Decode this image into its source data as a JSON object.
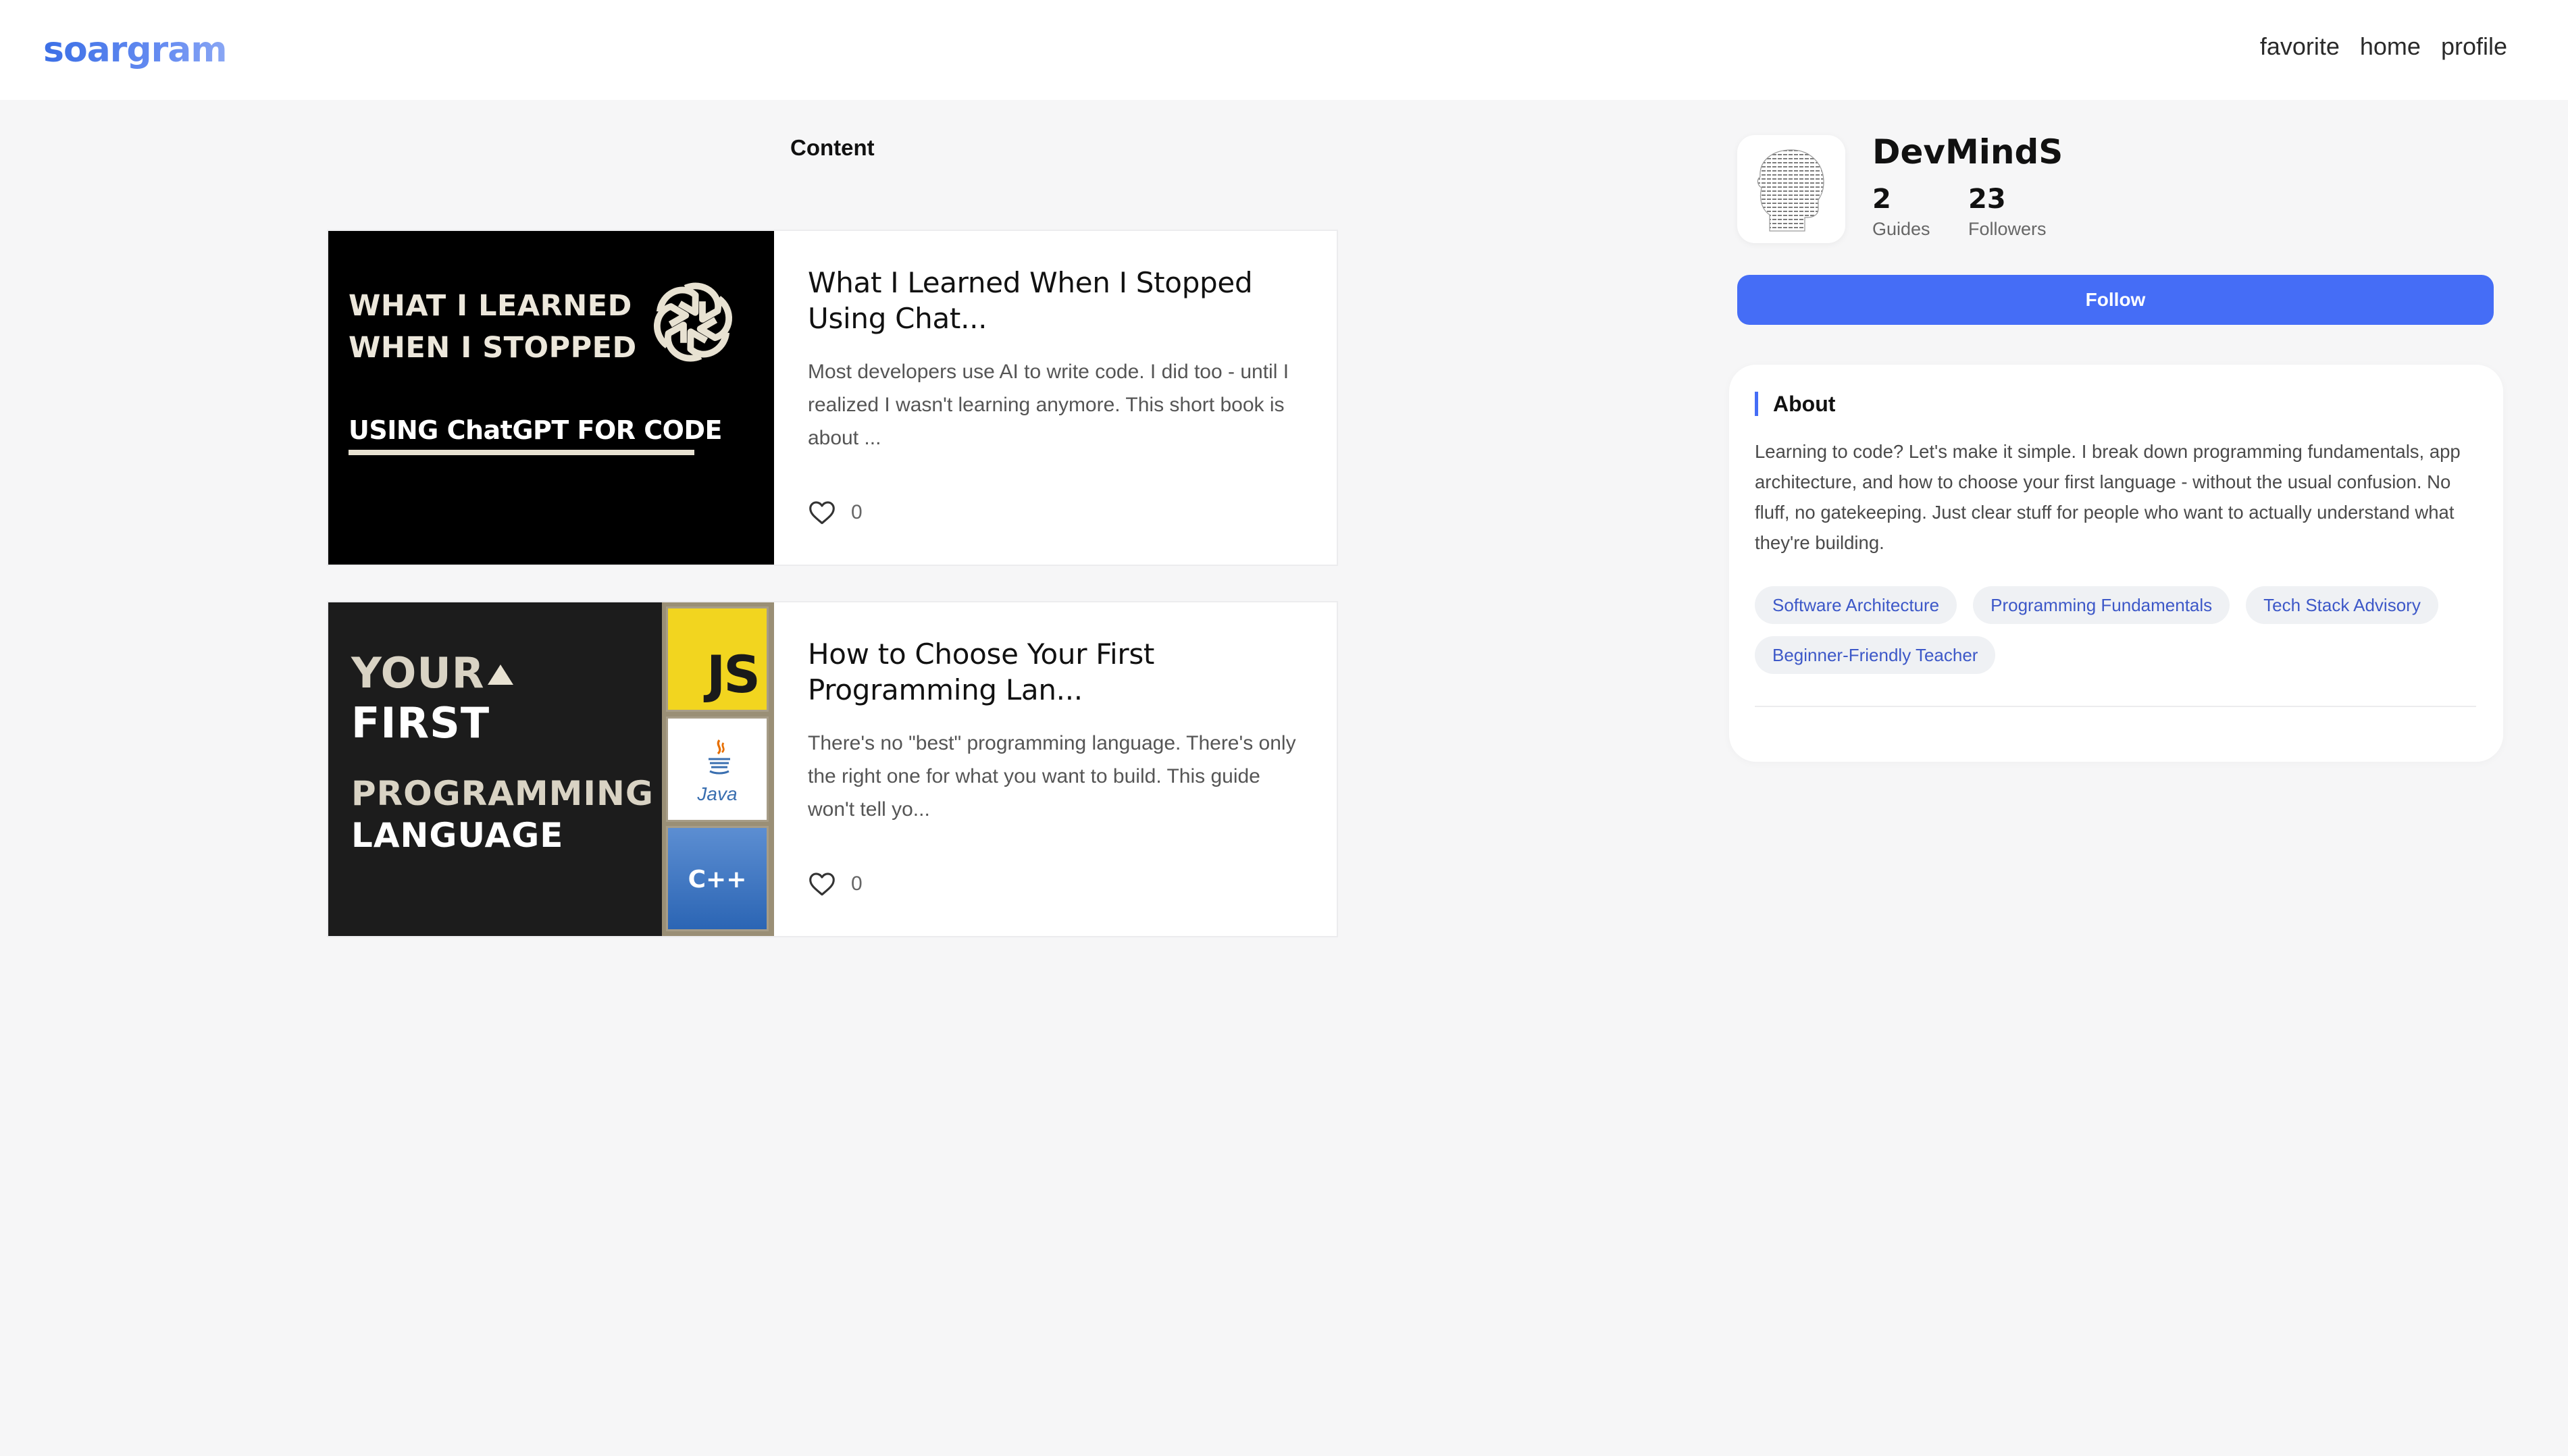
{
  "header": {
    "logo": "soargram",
    "nav": [
      "favorite",
      "home",
      "profile"
    ]
  },
  "content": {
    "section_title": "Content",
    "cards": [
      {
        "title": "What I Learned When I Stopped Using Chat...",
        "description": "Most developers use AI to write code. I did too - until I realized I wasn't learning anymore. This short book is about ...",
        "likes": "0",
        "thumbnail": {
          "lines": [
            "WHAT I LEARNED",
            "WHEN I STOPPED",
            "USING ChatGPT FOR CODE"
          ],
          "icon": "openai-knot-icon"
        }
      },
      {
        "title": "How to Choose Your First Programming Lan...",
        "description": "There's no \"best\" programming language. There's only the right one for what you want to build. This guide won't tell yo...",
        "likes": "0",
        "thumbnail": {
          "lines": [
            "YOUR",
            "FIRST",
            "PROGRAMMING",
            "LANGUAGE"
          ],
          "languages": [
            "JS",
            "Java",
            "C++"
          ]
        }
      }
    ]
  },
  "profile": {
    "name": "DevMindS",
    "guides_count": "2",
    "guides_label": "Guides",
    "followers_count": "23",
    "followers_label": "Followers",
    "follow_label": "Follow",
    "about_title": "About",
    "about_text": "Learning to code? Let's make it simple. I break down programming fundamentals, app architecture, and how to choose your first language - without the usual confusion. No fluff, no gatekeeping. Just clear stuff for people who want to actually understand what they're building.",
    "tags": [
      "Software Architecture",
      "Programming Fundamentals",
      "Tech Stack Advisory",
      "Beginner-Friendly Teacher"
    ]
  },
  "colors": {
    "accent": "#456df6",
    "page_bg": "#f6f6f7",
    "tag_text": "#3d58c8"
  }
}
